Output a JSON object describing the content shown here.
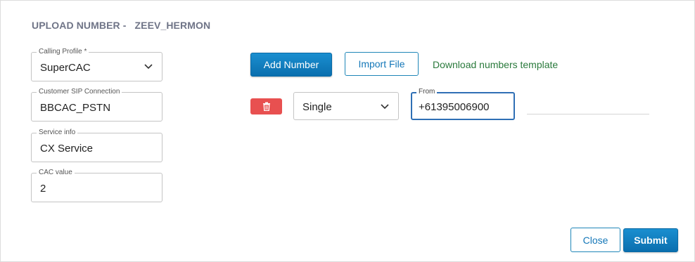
{
  "dialog": {
    "title_prefix": "UPLOAD NUMBER -",
    "title_name": "ZEEV_HERMON"
  },
  "form": {
    "calling_profile": {
      "label": "Calling Profile *",
      "value": "SuperCAC"
    },
    "customer_sip": {
      "label": "Customer SIP Connection",
      "value": "BBCAC_PSTN"
    },
    "service_info": {
      "label": "Service info",
      "value": "CX Service"
    },
    "cac_value": {
      "label": "CAC value",
      "value": "2"
    }
  },
  "actions": {
    "add_number": "Add Number",
    "import_file": "Import File",
    "download_template": "Download numbers template"
  },
  "number_row": {
    "type_value": "Single",
    "from_label": "From",
    "from_value": "+61395006900"
  },
  "footer": {
    "close": "Close",
    "submit": "Submit"
  },
  "colors": {
    "primary": "#0a6fae",
    "delete": "#e85050",
    "link": "#2a7a3c",
    "title": "#6f7487"
  },
  "icons": [
    "chevron-down-icon",
    "trash-icon"
  ]
}
